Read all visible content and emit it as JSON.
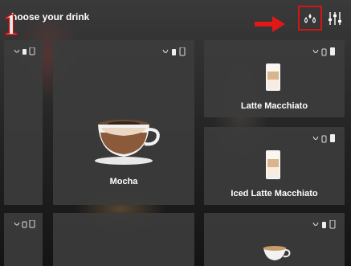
{
  "header": {
    "title": "hoose your drink",
    "step_marker": "1"
  },
  "tiles": [
    {
      "name": "Mocha"
    },
    {
      "name": "Latte Macchiato"
    },
    {
      "name": "Iced Latte Macchiato"
    }
  ],
  "colors": {
    "highlight": "#d41515",
    "tile_bg": "#3c3c3c"
  },
  "icons": {
    "drops": "water-drops-icon",
    "settings": "sliders-icon",
    "arrow": "red-arrow-icon"
  }
}
